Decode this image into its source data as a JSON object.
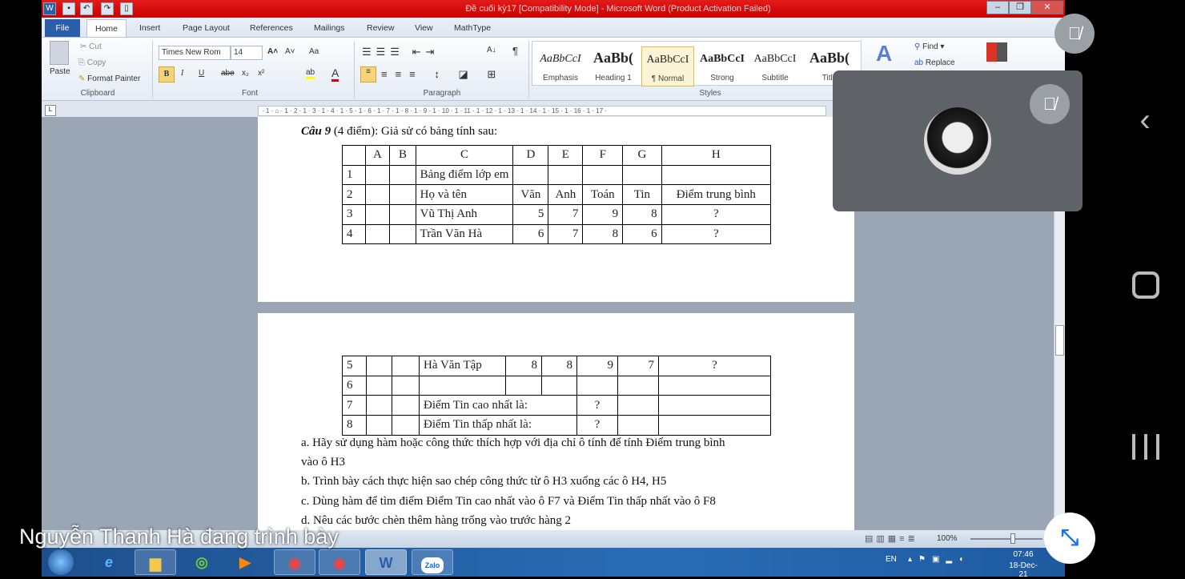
{
  "window": {
    "title": "Đề cuối kỳ17 [Compatibility Mode] - Microsoft Word (Product Activation Failed)",
    "minimize": "–",
    "restore": "❐",
    "close": "✕"
  },
  "tabs": [
    "File",
    "Home",
    "Insert",
    "Page Layout",
    "References",
    "Mailings",
    "Review",
    "View",
    "MathType"
  ],
  "ribbon": {
    "clipboard": {
      "paste": "Paste",
      "cut": "Cut",
      "copy": "Copy",
      "format_painter": "Format Painter",
      "label": "Clipboard"
    },
    "font": {
      "name": "Times New Rom",
      "size": "14",
      "bold": "B",
      "italic": "I",
      "underline": "U",
      "strike": "abe",
      "sub": "x₂",
      "sup": "x²",
      "grow": "A˄",
      "shrink": "A˅",
      "case": "Aa",
      "label": "Font"
    },
    "paragraph": {
      "label": "Paragraph",
      "pilcrow": "¶",
      "sort": "A↓"
    },
    "styles": {
      "items": [
        "Emphasis",
        "Heading 1",
        "¶ Normal",
        "Strong",
        "Subtitle",
        "Title"
      ],
      "sample": "AaBbCcI",
      "sample_big": "AaBb(",
      "selected": "¶ Normal",
      "label": "Styles"
    },
    "editing": {
      "find": "Find",
      "replace": "Replace"
    }
  },
  "ruler": "· 1 · ⌂ · 1 · 2 · 1 · 3 · 1 · 4 · 1 · 5 · 1 · 6 · 1 · 7 · 1 · 8 · 1 · 9 · 1 · 10 · 1 · 11 · 1 · 12 · 1 · 13 · 1 · 14 · 1 · 15 · 1 · 16 · 1 · 17 ·",
  "document": {
    "question_bold": "Câu 9",
    "question_rest": " (4 điểm): Giả sử có bảng tính sau:",
    "table1": [
      [
        "",
        "A",
        "B",
        "C",
        "D",
        "E",
        "F",
        "G",
        "H"
      ],
      [
        "1",
        "",
        "",
        "Bảng điểm lớp em",
        "",
        "",
        "",
        "",
        ""
      ],
      [
        "2",
        "",
        "",
        "Họ và tên",
        "Văn",
        "Anh",
        "Toán",
        "Tin",
        "Điểm trung bình"
      ],
      [
        "3",
        "",
        "",
        "Vũ Thị Anh",
        "5",
        "7",
        "9",
        "8",
        "?"
      ],
      [
        "4",
        "",
        "",
        "Trần Văn Hà",
        "6",
        "7",
        "8",
        "6",
        "?"
      ]
    ],
    "table2": [
      [
        "5",
        "",
        "",
        "Hà Văn Tập",
        "8",
        "8",
        "9",
        "7",
        "?"
      ],
      [
        "6",
        "",
        "",
        "",
        "",
        "",
        "",
        "",
        ""
      ],
      [
        "7",
        "",
        "",
        "Điểm Tin cao nhất là:",
        "?",
        "",
        ""
      ],
      [
        "8",
        "",
        "",
        "Điểm Tin thấp nhất là:",
        "?",
        "",
        ""
      ]
    ],
    "lines": [
      "a. Hãy sử dụng hàm hoặc công thức thích hợp với địa chỉ ô tính để tính Điểm trung bình",
      "vào ô H3",
      "b. Trình bày cách thực hiện sao chép công thức từ ô H3 xuống các ô H4, H5",
      "c. Dùng hàm để tìm điểm Điểm Tin cao nhất vào ô F7 và Điểm Tin thấp nhất vào ô F8",
      "d. Nêu các bước chèn thêm hàng trống vào trước hàng 2"
    ]
  },
  "status": {
    "zoom": "100%"
  },
  "taskbar": {
    "lang": "EN",
    "time": "07:46",
    "date": "18-Dec-21",
    "zalo": "Zalo"
  },
  "meeting": {
    "presenter_caption": "Nguyễn Thanh Hà đang trình bày"
  }
}
